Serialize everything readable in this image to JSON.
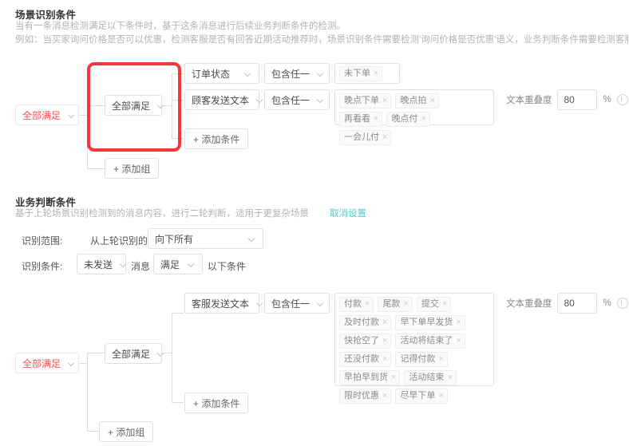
{
  "section1": {
    "title": "场景识别条件",
    "desc_line1": "当有一条消息检测满足以下条件时，基于这条消息进行后续业务判断条件的检测。",
    "desc_line2": "例如：当买家询问价格是否可以优惠，检测客服是否有回答近期活动推荐时，场景识别条件需要检测'询问价格是否优惠'语义，业务判断条件需要检测客服是否发送活动推荐话术。",
    "root_logic": "全部满足",
    "group_logic": "全部满足",
    "add_condition": "+ 添加条件",
    "add_group": "+ 添加组",
    "rows": [
      {
        "field": "订单状态",
        "operator": "包含任一",
        "tags": [
          "未下单"
        ]
      },
      {
        "field": "顾客发送文本",
        "operator": "包含任一",
        "tags": [
          "晚点下单",
          "晚点拍",
          "再看看",
          "晚点付",
          "一会儿付"
        ],
        "overlap_label": "文本重叠度",
        "overlap_value": "80",
        "overlap_unit": "%"
      }
    ]
  },
  "section2": {
    "title": "业务判断条件",
    "desc": "基于上轮场景识别检测到的消息内容，进行二轮判断，适用于更复杂场景",
    "cancel_link": "取消设置",
    "scope_label": "识别范围:",
    "scope_prefix": "从上轮识别的会话消息",
    "scope_value": "向下所有",
    "cond_label": "识别条件:",
    "cond_sent": "未发送",
    "cond_mid": "消息",
    "cond_satisfy": "满足",
    "cond_suffix": "以下条件",
    "root_logic": "全部满足",
    "group_logic": "全部满足",
    "add_condition": "+ 添加条件",
    "add_group": "+ 添加组",
    "rows": [
      {
        "field": "客服发送文本",
        "operator": "包含任一",
        "tags": [
          "付款",
          "尾款",
          "提交",
          "及时付款",
          "早下单早发货",
          "快抢空了",
          "活动将结束了",
          "还没付款",
          "记得付款",
          "早拍早到货",
          "活动结束",
          "限时优惠",
          "尽早下单"
        ],
        "overlap_label": "文本重叠度",
        "overlap_value": "80",
        "overlap_unit": "%"
      }
    ]
  },
  "colors": {
    "accent_red": "#ff4d4f",
    "annotation_red": "#f5373c",
    "link_teal": "#4ecdc4",
    "border": "#e0e0e0",
    "muted_text": "#b3b3b3"
  }
}
